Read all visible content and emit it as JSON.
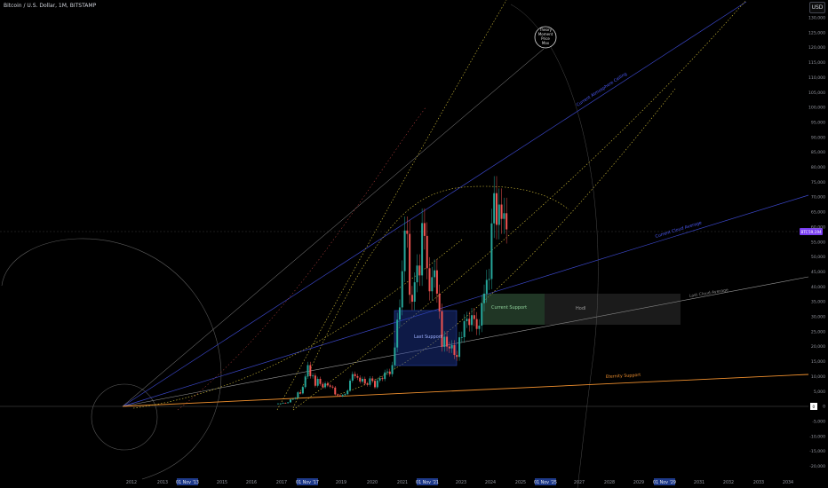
{
  "header": {
    "title": "Bitcoin / U.S. Dollar, 1M, BITSTAMP"
  },
  "currency": "USD",
  "price_badge": {
    "label": "BTC",
    "value": "59,194"
  },
  "colors": {
    "up": "#26a69a",
    "down": "#ef5350",
    "blue": "#3b47c9",
    "orange": "#f0902e",
    "yellow": "#d8c43a",
    "gray": "#8a8a8a",
    "badge": "#7a3ff2"
  },
  "chart_data": {
    "type": "line",
    "title": "Bitcoin / U.S. Dollar, 1M, BITSTAMP",
    "y_ticks": [
      "130,000",
      "125,000",
      "120,000",
      "115,000",
      "110,000",
      "105,000",
      "100,000",
      "95,000",
      "90,000",
      "85,000",
      "80,000",
      "75,000",
      "70,000",
      "65,000",
      "60,000",
      "55,000",
      "50,000",
      "45,000",
      "40,000",
      "35,000",
      "30,000",
      "25,000",
      "20,000",
      "15,000",
      "10,000",
      "5,000",
      "0",
      "-5,000",
      "-10,000",
      "-15,000",
      "-20,000"
    ],
    "x_ticks": [
      "2012",
      "2013",
      "01 Nov '13",
      "2015",
      "2016",
      "2017",
      "01 Nov '17",
      "2019",
      "2020",
      "2021",
      "01 Nov '21",
      "2023",
      "2024",
      "2025",
      "01 Nov '25",
      "2027",
      "2028",
      "2029",
      "01 Nov '29",
      "2031",
      "2032",
      "2033",
      "2034"
    ],
    "highlighted_x": [
      "01 Nov '13",
      "01 Nov '17",
      "01 Nov '21",
      "01 Nov '25",
      "01 Nov '29"
    ],
    "ylim": [
      -20000,
      130000
    ],
    "candles_monthly_close": [
      [
        "2016-12",
        960
      ],
      [
        "2017-01",
        970
      ],
      [
        "2017-02",
        1190
      ],
      [
        "2017-03",
        1080
      ],
      [
        "2017-04",
        1350
      ],
      [
        "2017-05",
        2300
      ],
      [
        "2017-06",
        2480
      ],
      [
        "2017-07",
        2870
      ],
      [
        "2017-08",
        4700
      ],
      [
        "2017-09",
        4340
      ],
      [
        "2017-10",
        6450
      ],
      [
        "2017-11",
        10000
      ],
      [
        "2017-12",
        13800
      ],
      [
        "2018-01",
        10100
      ],
      [
        "2018-02",
        10300
      ],
      [
        "2018-03",
        6900
      ],
      [
        "2018-04",
        9200
      ],
      [
        "2018-05",
        7500
      ],
      [
        "2018-06",
        6400
      ],
      [
        "2018-07",
        7700
      ],
      [
        "2018-08",
        7000
      ],
      [
        "2018-09",
        6600
      ],
      [
        "2018-10",
        6300
      ],
      [
        "2018-11",
        4000
      ],
      [
        "2018-12",
        3700
      ],
      [
        "2019-01",
        3400
      ],
      [
        "2019-02",
        3800
      ],
      [
        "2019-03",
        4100
      ],
      [
        "2019-04",
        5300
      ],
      [
        "2019-05",
        8600
      ],
      [
        "2019-06",
        10800
      ],
      [
        "2019-07",
        10100
      ],
      [
        "2019-08",
        9600
      ],
      [
        "2019-09",
        8300
      ],
      [
        "2019-10",
        9200
      ],
      [
        "2019-11",
        7600
      ],
      [
        "2019-12",
        7200
      ],
      [
        "2020-01",
        9350
      ],
      [
        "2020-02",
        8550
      ],
      [
        "2020-03",
        6400
      ],
      [
        "2020-04",
        8650
      ],
      [
        "2020-05",
        9450
      ],
      [
        "2020-06",
        9150
      ],
      [
        "2020-07",
        11350
      ],
      [
        "2020-08",
        11650
      ],
      [
        "2020-09",
        10780
      ],
      [
        "2020-10",
        13800
      ],
      [
        "2020-11",
        19700
      ],
      [
        "2020-12",
        29000
      ],
      [
        "2021-01",
        33100
      ],
      [
        "2021-02",
        45200
      ],
      [
        "2021-03",
        58800
      ],
      [
        "2021-04",
        57700
      ],
      [
        "2021-05",
        37300
      ],
      [
        "2021-06",
        35000
      ],
      [
        "2021-07",
        41500
      ],
      [
        "2021-08",
        47100
      ],
      [
        "2021-09",
        43800
      ],
      [
        "2021-10",
        61300
      ],
      [
        "2021-11",
        57000
      ],
      [
        "2021-12",
        46200
      ],
      [
        "2022-01",
        38500
      ],
      [
        "2022-02",
        43200
      ],
      [
        "2022-03",
        45500
      ],
      [
        "2022-04",
        37700
      ],
      [
        "2022-05",
        31800
      ],
      [
        "2022-06",
        19900
      ],
      [
        "2022-07",
        23300
      ],
      [
        "2022-08",
        20000
      ],
      [
        "2022-09",
        19400
      ],
      [
        "2022-10",
        20500
      ],
      [
        "2022-11",
        17200
      ],
      [
        "2022-12",
        16550
      ],
      [
        "2023-01",
        23100
      ],
      [
        "2023-02",
        23150
      ],
      [
        "2023-03",
        28500
      ],
      [
        "2023-04",
        29300
      ],
      [
        "2023-05",
        27200
      ],
      [
        "2023-06",
        30500
      ],
      [
        "2023-07",
        29200
      ],
      [
        "2023-08",
        25900
      ],
      [
        "2023-09",
        27000
      ],
      [
        "2023-10",
        34500
      ],
      [
        "2023-11",
        37700
      ],
      [
        "2023-12",
        42300
      ],
      [
        "2024-01",
        42600
      ],
      [
        "2024-02",
        61200
      ],
      [
        "2024-03",
        71300
      ],
      [
        "2024-04",
        60700
      ],
      [
        "2024-05",
        67500
      ],
      [
        "2024-06",
        62700
      ],
      [
        "2024-07",
        64600
      ],
      [
        "2024-08",
        59194
      ]
    ],
    "annotations": {
      "theory_label": [
        "Theory",
        "Moment",
        "Price",
        "Max"
      ],
      "current_atmosphere_ceiling": "Current Atmosphere Ceiling",
      "current_cloud_average": "Current Cloud Average",
      "last_cloud_average": "Last Cloud Average",
      "eternity_support": "Eternity Support",
      "last_support": "Last Support",
      "current_support": "Current Support",
      "hodl": "Hodl"
    }
  }
}
